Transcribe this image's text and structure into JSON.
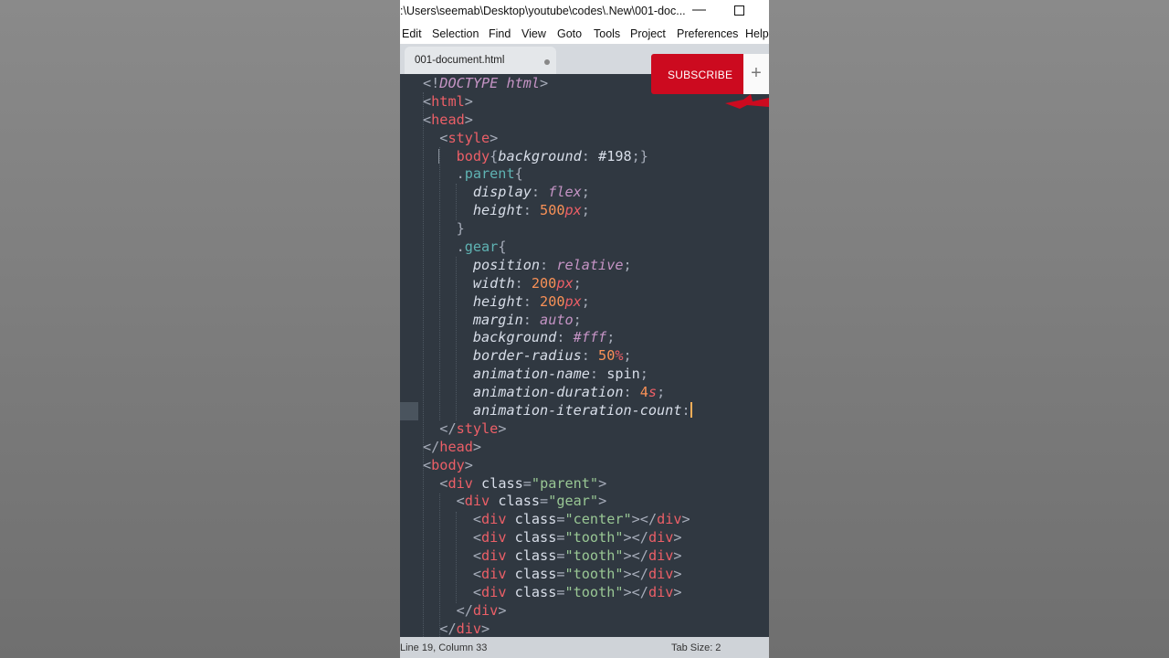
{
  "window": {
    "title": ":\\Users\\seemab\\Desktop\\youtube\\codes\\.New\\001-doc...",
    "minimize_glyph": "—"
  },
  "menu": [
    "Edit",
    "Selection",
    "Find",
    "View",
    "Goto",
    "Tools",
    "Project",
    "Preferences",
    "Help"
  ],
  "tab": {
    "label": "001-document.html",
    "unsaved": true
  },
  "status": {
    "position": "Line 19, Column 33",
    "tab_size": "Tab Size: 2"
  },
  "overlay": {
    "subscribe_label": "SUBSCRIBE",
    "plus_glyph": "+"
  },
  "editor": {
    "lines": [
      [
        [
          "p",
          "<!"
        ],
        [
          "k",
          "DOCTYPE"
        ],
        [
          "x",
          " "
        ],
        [
          "k",
          "html"
        ],
        [
          "p",
          ">"
        ]
      ],
      [
        [
          "p",
          "<"
        ],
        [
          "t",
          "html"
        ],
        [
          "p",
          ">"
        ]
      ],
      [
        [
          "p",
          "<"
        ],
        [
          "t",
          "head"
        ],
        [
          "p",
          ">"
        ]
      ],
      [
        [
          "x",
          "  "
        ],
        [
          "p",
          "<"
        ],
        [
          "t",
          "style"
        ],
        [
          "p",
          ">"
        ]
      ],
      [
        [
          "x",
          "    "
        ],
        [
          "t",
          "body"
        ],
        [
          "p",
          "{"
        ],
        [
          "a",
          "background"
        ],
        [
          "p",
          ": "
        ],
        [
          "x",
          "#198"
        ],
        [
          "p",
          ";}"
        ]
      ],
      [
        [
          "x",
          "    "
        ],
        [
          "p",
          "."
        ],
        [
          "cls",
          "parent"
        ],
        [
          "p",
          "{"
        ]
      ],
      [
        [
          "x",
          "      "
        ],
        [
          "a",
          "display"
        ],
        [
          "p",
          ": "
        ],
        [
          "v",
          "flex"
        ],
        [
          "p",
          ";"
        ]
      ],
      [
        [
          "x",
          "      "
        ],
        [
          "a",
          "height"
        ],
        [
          "p",
          ": "
        ],
        [
          "n",
          "500"
        ],
        [
          "u",
          "px"
        ],
        [
          "p",
          ";"
        ]
      ],
      [
        [
          "x",
          "    "
        ],
        [
          "p",
          "}"
        ]
      ],
      [
        [
          "x",
          "    "
        ],
        [
          "p",
          "."
        ],
        [
          "cls",
          "gear"
        ],
        [
          "p",
          "{"
        ]
      ],
      [
        [
          "x",
          "      "
        ],
        [
          "a",
          "position"
        ],
        [
          "p",
          ": "
        ],
        [
          "v",
          "relative"
        ],
        [
          "p",
          ";"
        ]
      ],
      [
        [
          "x",
          "      "
        ],
        [
          "a",
          "width"
        ],
        [
          "p",
          ": "
        ],
        [
          "n",
          "200"
        ],
        [
          "u",
          "px"
        ],
        [
          "p",
          ";"
        ]
      ],
      [
        [
          "x",
          "      "
        ],
        [
          "a",
          "height"
        ],
        [
          "p",
          ": "
        ],
        [
          "n",
          "200"
        ],
        [
          "u",
          "px"
        ],
        [
          "p",
          ";"
        ]
      ],
      [
        [
          "x",
          "      "
        ],
        [
          "a",
          "margin"
        ],
        [
          "p",
          ": "
        ],
        [
          "v",
          "auto"
        ],
        [
          "p",
          ";"
        ]
      ],
      [
        [
          "x",
          "      "
        ],
        [
          "a",
          "background"
        ],
        [
          "p",
          ": "
        ],
        [
          "v",
          "#fff"
        ],
        [
          "p",
          ";"
        ]
      ],
      [
        [
          "x",
          "      "
        ],
        [
          "a",
          "border-radius"
        ],
        [
          "p",
          ": "
        ],
        [
          "n",
          "50"
        ],
        [
          "u",
          "%"
        ],
        [
          "p",
          ";"
        ]
      ],
      [
        [
          "x",
          "      "
        ],
        [
          "a",
          "animation-name"
        ],
        [
          "p",
          ": "
        ],
        [
          "x",
          "spin"
        ],
        [
          "p",
          ";"
        ]
      ],
      [
        [
          "x",
          "      "
        ],
        [
          "a",
          "animation-duration"
        ],
        [
          "p",
          ": "
        ],
        [
          "n",
          "4"
        ],
        [
          "u",
          "s"
        ],
        [
          "p",
          ";"
        ]
      ],
      [
        [
          "x",
          "      "
        ],
        [
          "a",
          "animation-iteration-count"
        ],
        [
          "p",
          ":"
        ],
        [
          "cursor",
          ""
        ]
      ],
      [
        [
          "x",
          "  "
        ],
        [
          "p",
          "</"
        ],
        [
          "t",
          "style"
        ],
        [
          "p",
          ">"
        ]
      ],
      [
        [
          "p",
          "</"
        ],
        [
          "t",
          "head"
        ],
        [
          "p",
          ">"
        ]
      ],
      [
        [
          "p",
          "<"
        ],
        [
          "t",
          "body"
        ],
        [
          "p",
          ">"
        ]
      ],
      [
        [
          "x",
          "  "
        ],
        [
          "p",
          "<"
        ],
        [
          "t",
          "div"
        ],
        [
          "x",
          " "
        ],
        [
          "at",
          "class"
        ],
        [
          "p",
          "="
        ],
        [
          "s",
          "\"parent\""
        ],
        [
          "p",
          ">"
        ]
      ],
      [
        [
          "x",
          "    "
        ],
        [
          "p",
          "<"
        ],
        [
          "t",
          "div"
        ],
        [
          "x",
          " "
        ],
        [
          "at",
          "class"
        ],
        [
          "p",
          "="
        ],
        [
          "s",
          "\"gear\""
        ],
        [
          "p",
          ">"
        ]
      ],
      [
        [
          "x",
          "      "
        ],
        [
          "p",
          "<"
        ],
        [
          "t",
          "div"
        ],
        [
          "x",
          " "
        ],
        [
          "at",
          "class"
        ],
        [
          "p",
          "="
        ],
        [
          "s",
          "\"center\""
        ],
        [
          "p",
          "></"
        ],
        [
          "t",
          "div"
        ],
        [
          "p",
          ">"
        ]
      ],
      [
        [
          "x",
          "      "
        ],
        [
          "p",
          "<"
        ],
        [
          "t",
          "div"
        ],
        [
          "x",
          " "
        ],
        [
          "at",
          "class"
        ],
        [
          "p",
          "="
        ],
        [
          "s",
          "\"tooth\""
        ],
        [
          "p",
          "></"
        ],
        [
          "t",
          "div"
        ],
        [
          "p",
          ">"
        ]
      ],
      [
        [
          "x",
          "      "
        ],
        [
          "p",
          "<"
        ],
        [
          "t",
          "div"
        ],
        [
          "x",
          " "
        ],
        [
          "at",
          "class"
        ],
        [
          "p",
          "="
        ],
        [
          "s",
          "\"tooth\""
        ],
        [
          "p",
          "></"
        ],
        [
          "t",
          "div"
        ],
        [
          "p",
          ">"
        ]
      ],
      [
        [
          "x",
          "      "
        ],
        [
          "p",
          "<"
        ],
        [
          "t",
          "div"
        ],
        [
          "x",
          " "
        ],
        [
          "at",
          "class"
        ],
        [
          "p",
          "="
        ],
        [
          "s",
          "\"tooth\""
        ],
        [
          "p",
          "></"
        ],
        [
          "t",
          "div"
        ],
        [
          "p",
          ">"
        ]
      ],
      [
        [
          "x",
          "      "
        ],
        [
          "p",
          "<"
        ],
        [
          "t",
          "div"
        ],
        [
          "x",
          " "
        ],
        [
          "at",
          "class"
        ],
        [
          "p",
          "="
        ],
        [
          "s",
          "\"tooth\""
        ],
        [
          "p",
          "></"
        ],
        [
          "t",
          "div"
        ],
        [
          "p",
          ">"
        ]
      ],
      [
        [
          "x",
          "    "
        ],
        [
          "p",
          "</"
        ],
        [
          "t",
          "div"
        ],
        [
          "p",
          ">"
        ]
      ],
      [
        [
          "x",
          "  "
        ],
        [
          "p",
          "</"
        ],
        [
          "t",
          "div"
        ],
        [
          "p",
          ">"
        ]
      ]
    ]
  }
}
